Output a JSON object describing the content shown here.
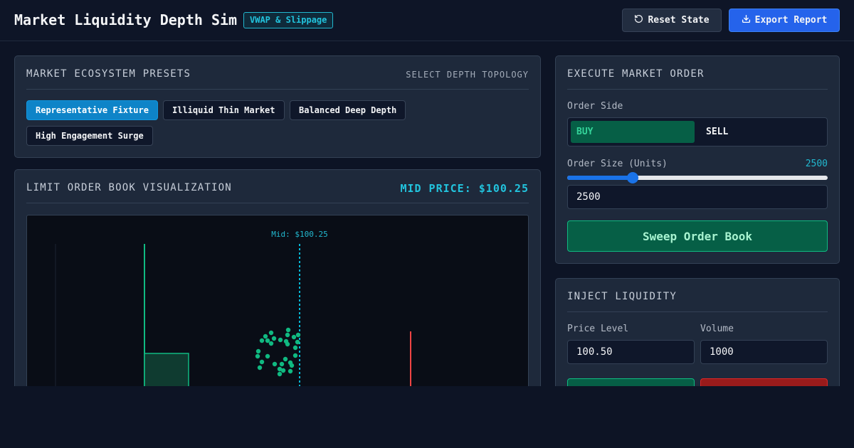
{
  "header": {
    "title": "Market Liquidity Depth Sim",
    "badge": "VWAP & Slippage",
    "reset_label": "Reset State",
    "export_label": "Export Report"
  },
  "presets": {
    "title": "MARKET ECOSYSTEM PRESETS",
    "subtitle": "SELECT DEPTH TOPOLOGY",
    "items": [
      {
        "label": "Representative Fixture",
        "active": true
      },
      {
        "label": "Illiquid Thin Market",
        "active": false
      },
      {
        "label": "Balanced Deep Depth",
        "active": false
      },
      {
        "label": "High Engagement Surge",
        "active": false
      }
    ]
  },
  "book": {
    "title": "LIMIT ORDER BOOK VISUALIZATION",
    "mid_price_label": "MID PRICE: $100.25",
    "mid_marker": "Mid: $100.25"
  },
  "order": {
    "title": "EXECUTE MARKET ORDER",
    "side_label": "Order Side",
    "buy_label": "BUY",
    "sell_label": "SELL",
    "selected_side": "BUY",
    "size_label": "Order Size (Units)",
    "size_value": "2500",
    "size_fraction": 0.25,
    "input_value": "2500",
    "sweep_label": "Sweep Order Book"
  },
  "inject": {
    "title": "INJECT LIQUIDITY",
    "price_label": "Price Level",
    "volume_label": "Volume",
    "price_value": "100.50",
    "volume_value": "1000"
  },
  "colors": {
    "bid": "#10b981",
    "ask": "#ef4444",
    "mid": "#06b6d4",
    "accent": "#2563eb"
  }
}
